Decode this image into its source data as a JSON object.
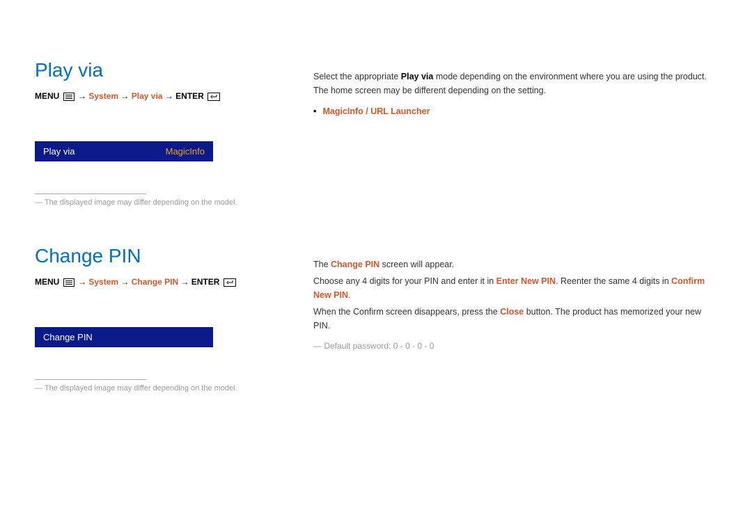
{
  "section1": {
    "title": "Play via",
    "nav": {
      "menu": "MENU",
      "arrow": " → ",
      "part1": "System",
      "part2": "Play via",
      "enter": "ENTER"
    },
    "osd": {
      "label": "Play via",
      "value": "MagicInfo"
    },
    "note": "The displayed image may differ depending on the model.",
    "body1_a": "Select the appropriate ",
    "body1_b": "Play via",
    "body1_c": " mode depending on the environment where you are using the product.",
    "body2": "The home screen may be different depending on the setting.",
    "bullet": "MagicInfo / URL Launcher"
  },
  "section2": {
    "title": "Change PIN",
    "nav": {
      "menu": "MENU",
      "arrow": " → ",
      "part1": "System",
      "part2": "Change PIN",
      "enter": "ENTER"
    },
    "osd": {
      "label": "Change PIN"
    },
    "note": "The displayed image may differ depending on the model.",
    "p1_a": "The ",
    "p1_b": "Change PIN",
    "p1_c": " screen will appear.",
    "p2_a": "Choose any 4 digits for your PIN and enter it in ",
    "p2_b": "Enter New PIN",
    "p2_c": ". Reenter the same 4 digits in ",
    "p2_d": "Confirm New PIN",
    "p2_e": ".",
    "p3_a": "When the Confirm screen disappears, press the ",
    "p3_b": "Close",
    "p3_c": " button. The product has memorized your new PIN.",
    "default": "Default password: 0 - 0 - 0 - 0"
  }
}
